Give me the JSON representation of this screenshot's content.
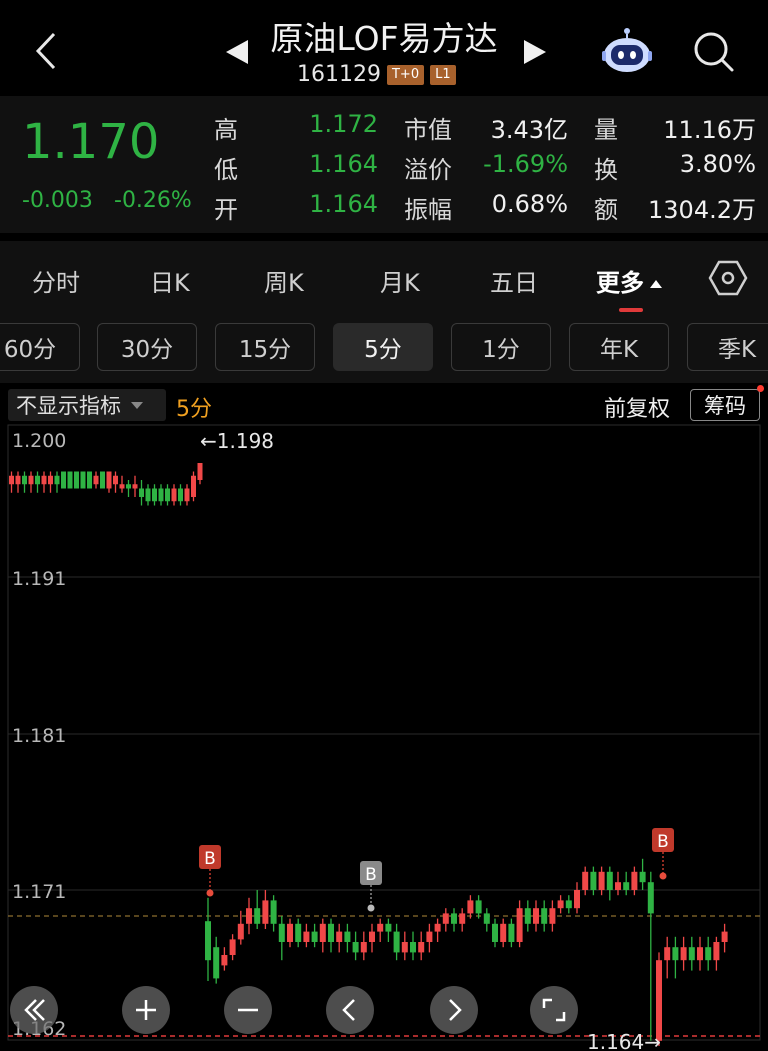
{
  "header": {
    "title": "原油LOF易方达",
    "code": "161129",
    "tags": [
      "T+0",
      "L1"
    ]
  },
  "quote": {
    "price": "1.170",
    "change": "-0.003",
    "change_pct": "-0.26%",
    "high_label": "高",
    "high": "1.172",
    "low_label": "低",
    "low": "1.164",
    "open_label": "开",
    "open": "1.164",
    "mktcap_label": "市值",
    "mktcap": "3.43亿",
    "premium_label": "溢价",
    "premium": "-1.69%",
    "amplitude_label": "振幅",
    "amplitude": "0.68%",
    "volume_label": "量",
    "volume": "11.16万",
    "turnover_label": "换",
    "turnover": "3.80%",
    "amount_label": "额",
    "amount": "1304.2万",
    "colors": {
      "down": "#2fb344",
      "up": "#f04848"
    }
  },
  "tabs": [
    "分时",
    "日K",
    "周K",
    "月K",
    "五日",
    "更多"
  ],
  "active_tab": "更多",
  "periods": [
    "60分",
    "30分",
    "15分",
    "5分",
    "1分",
    "年K",
    "季K"
  ],
  "selected_period": "5分",
  "chart_toolbar": {
    "indicator_label": "不显示指标",
    "indicator_value": "5分",
    "adjust_label": "前复权",
    "chip_label": "筹码"
  },
  "chart_data": {
    "type": "candlestick",
    "y_ticks": [
      "1.200",
      "1.191",
      "1.181",
      "1.171",
      "1.162"
    ],
    "ylim": [
      1.162,
      1.2
    ],
    "reference_price": 1.17,
    "max_label": "←1.198",
    "min_label": "1.164→",
    "signals": [
      {
        "label": "B",
        "style": "red"
      },
      {
        "label": "B",
        "style": "gray"
      },
      {
        "label": "B",
        "style": "red"
      }
    ],
    "candles_top": [
      {
        "o": 1.1946,
        "c": 1.195,
        "h": 1.1952,
        "l": 1.1942
      },
      {
        "o": 1.1946,
        "c": 1.195,
        "h": 1.1952,
        "l": 1.1942
      },
      {
        "o": 1.195,
        "c": 1.1946,
        "h": 1.1952,
        "l": 1.1942
      },
      {
        "o": 1.1946,
        "c": 1.195,
        "h": 1.1952,
        "l": 1.1942
      },
      {
        "o": 1.195,
        "c": 1.1946,
        "h": 1.1952,
        "l": 1.1942
      },
      {
        "o": 1.1946,
        "c": 1.195,
        "h": 1.1952,
        "l": 1.1942
      },
      {
        "o": 1.1946,
        "c": 1.195,
        "h": 1.1952,
        "l": 1.1942
      },
      {
        "o": 1.195,
        "c": 1.1946,
        "h": 1.1952,
        "l": 1.1942
      },
      {
        "o": 1.1952,
        "c": 1.1944,
        "h": 1.1952,
        "l": 1.1944
      },
      {
        "o": 1.1952,
        "c": 1.1944,
        "h": 1.1952,
        "l": 1.1944
      },
      {
        "o": 1.1952,
        "c": 1.1944,
        "h": 1.1952,
        "l": 1.1944
      },
      {
        "o": 1.1952,
        "c": 1.1944,
        "h": 1.1952,
        "l": 1.1944
      },
      {
        "o": 1.1952,
        "c": 1.1944,
        "h": 1.1952,
        "l": 1.1944
      },
      {
        "o": 1.1946,
        "c": 1.195,
        "h": 1.1952,
        "l": 1.1944
      },
      {
        "o": 1.1952,
        "c": 1.1944,
        "h": 1.1952,
        "l": 1.1944
      },
      {
        "o": 1.1944,
        "c": 1.1952,
        "h": 1.1952,
        "l": 1.1942
      },
      {
        "o": 1.1946,
        "c": 1.195,
        "h": 1.1952,
        "l": 1.1942
      },
      {
        "o": 1.1944,
        "c": 1.1946,
        "h": 1.195,
        "l": 1.1942
      },
      {
        "o": 1.1946,
        "c": 1.1944,
        "h": 1.1948,
        "l": 1.194
      },
      {
        "o": 1.1944,
        "c": 1.1946,
        "h": 1.195,
        "l": 1.194
      },
      {
        "o": 1.1944,
        "c": 1.194,
        "h": 1.1948,
        "l": 1.1936
      },
      {
        "o": 1.1944,
        "c": 1.1938,
        "h": 1.1946,
        "l": 1.1936
      },
      {
        "o": 1.1944,
        "c": 1.1938,
        "h": 1.1946,
        "l": 1.1936
      },
      {
        "o": 1.1944,
        "c": 1.1938,
        "h": 1.1946,
        "l": 1.1936
      },
      {
        "o": 1.1944,
        "c": 1.1938,
        "h": 1.1946,
        "l": 1.1936
      },
      {
        "o": 1.1938,
        "c": 1.1944,
        "h": 1.1946,
        "l": 1.1936
      },
      {
        "o": 1.1944,
        "c": 1.1938,
        "h": 1.1946,
        "l": 1.1936
      },
      {
        "o": 1.1938,
        "c": 1.1944,
        "h": 1.1946,
        "l": 1.1936
      },
      {
        "o": 1.194,
        "c": 1.195,
        "h": 1.1952,
        "l": 1.1938
      },
      {
        "o": 1.1948,
        "c": 1.1956,
        "h": 1.1956,
        "l": 1.1946
      }
    ],
    "candles_bottom": [
      {
        "o": 1.1698,
        "c": 1.1683,
        "h": 1.1707,
        "l": 1.1675
      },
      {
        "o": 1.1688,
        "c": 1.1676,
        "h": 1.1692,
        "l": 1.1674
      },
      {
        "o": 1.1681,
        "c": 1.1685,
        "h": 1.1688,
        "l": 1.1679
      },
      {
        "o": 1.1685,
        "c": 1.1691,
        "h": 1.1693,
        "l": 1.1683
      },
      {
        "o": 1.1691,
        "c": 1.1697,
        "h": 1.1702,
        "l": 1.1689
      },
      {
        "o": 1.1697,
        "c": 1.1703,
        "h": 1.1707,
        "l": 1.1693
      },
      {
        "o": 1.1703,
        "c": 1.1697,
        "h": 1.171,
        "l": 1.1695
      },
      {
        "o": 1.1697,
        "c": 1.1706,
        "h": 1.171,
        "l": 1.1695
      },
      {
        "o": 1.1706,
        "c": 1.1697,
        "h": 1.1708,
        "l": 1.1694
      },
      {
        "o": 1.1697,
        "c": 1.169,
        "h": 1.17,
        "l": 1.1683
      },
      {
        "o": 1.169,
        "c": 1.1697,
        "h": 1.1699,
        "l": 1.1688
      },
      {
        "o": 1.1697,
        "c": 1.169,
        "h": 1.1699,
        "l": 1.1688
      },
      {
        "o": 1.169,
        "c": 1.1694,
        "h": 1.1697,
        "l": 1.1688
      },
      {
        "o": 1.1694,
        "c": 1.169,
        "h": 1.1697,
        "l": 1.1688
      },
      {
        "o": 1.169,
        "c": 1.1697,
        "h": 1.1699,
        "l": 1.1686
      },
      {
        "o": 1.1697,
        "c": 1.169,
        "h": 1.1699,
        "l": 1.1686
      },
      {
        "o": 1.169,
        "c": 1.1694,
        "h": 1.1697,
        "l": 1.1686
      },
      {
        "o": 1.1694,
        "c": 1.169,
        "h": 1.1697,
        "l": 1.1686
      },
      {
        "o": 1.169,
        "c": 1.1686,
        "h": 1.1694,
        "l": 1.1683
      },
      {
        "o": 1.1686,
        "c": 1.169,
        "h": 1.1694,
        "l": 1.1683
      },
      {
        "o": 1.169,
        "c": 1.1694,
        "h": 1.1697,
        "l": 1.1686
      },
      {
        "o": 1.1694,
        "c": 1.1697,
        "h": 1.1699,
        "l": 1.169
      },
      {
        "o": 1.1697,
        "c": 1.1694,
        "h": 1.1699,
        "l": 1.169
      },
      {
        "o": 1.1694,
        "c": 1.1686,
        "h": 1.1697,
        "l": 1.1683
      },
      {
        "o": 1.1686,
        "c": 1.169,
        "h": 1.1694,
        "l": 1.1683
      },
      {
        "o": 1.169,
        "c": 1.1686,
        "h": 1.1694,
        "l": 1.1683
      },
      {
        "o": 1.1686,
        "c": 1.169,
        "h": 1.1694,
        "l": 1.1683
      },
      {
        "o": 1.169,
        "c": 1.1694,
        "h": 1.1697,
        "l": 1.1686
      },
      {
        "o": 1.1694,
        "c": 1.1697,
        "h": 1.1699,
        "l": 1.169
      },
      {
        "o": 1.1697,
        "c": 1.1701,
        "h": 1.1703,
        "l": 1.1694
      },
      {
        "o": 1.1701,
        "c": 1.1697,
        "h": 1.1703,
        "l": 1.1694
      },
      {
        "o": 1.1697,
        "c": 1.1701,
        "h": 1.1703,
        "l": 1.1694
      },
      {
        "o": 1.1701,
        "c": 1.1706,
        "h": 1.1708,
        "l": 1.1699
      },
      {
        "o": 1.1706,
        "c": 1.1701,
        "h": 1.1708,
        "l": 1.1699
      },
      {
        "o": 1.1701,
        "c": 1.1697,
        "h": 1.1703,
        "l": 1.1694
      },
      {
        "o": 1.1697,
        "c": 1.169,
        "h": 1.1699,
        "l": 1.1688
      },
      {
        "o": 1.169,
        "c": 1.1697,
        "h": 1.1699,
        "l": 1.1688
      },
      {
        "o": 1.1697,
        "c": 1.169,
        "h": 1.1699,
        "l": 1.1688
      },
      {
        "o": 1.169,
        "c": 1.1703,
        "h": 1.1706,
        "l": 1.1688
      },
      {
        "o": 1.1703,
        "c": 1.1697,
        "h": 1.1706,
        "l": 1.1694
      },
      {
        "o": 1.1697,
        "c": 1.1703,
        "h": 1.1706,
        "l": 1.1694
      },
      {
        "o": 1.1703,
        "c": 1.1697,
        "h": 1.1706,
        "l": 1.1694
      },
      {
        "o": 1.1697,
        "c": 1.1703,
        "h": 1.1706,
        "l": 1.1694
      },
      {
        "o": 1.1703,
        "c": 1.1706,
        "h": 1.1708,
        "l": 1.1701
      },
      {
        "o": 1.1706,
        "c": 1.1703,
        "h": 1.1708,
        "l": 1.1701
      },
      {
        "o": 1.1703,
        "c": 1.171,
        "h": 1.1713,
        "l": 1.1701
      },
      {
        "o": 1.171,
        "c": 1.1717,
        "h": 1.1719,
        "l": 1.1708
      },
      {
        "o": 1.1717,
        "c": 1.171,
        "h": 1.1719,
        "l": 1.1708
      },
      {
        "o": 1.171,
        "c": 1.1717,
        "h": 1.1719,
        "l": 1.1708
      },
      {
        "o": 1.1717,
        "c": 1.171,
        "h": 1.1719,
        "l": 1.1706
      },
      {
        "o": 1.171,
        "c": 1.1713,
        "h": 1.1717,
        "l": 1.1708
      },
      {
        "o": 1.1713,
        "c": 1.171,
        "h": 1.1717,
        "l": 1.1708
      },
      {
        "o": 1.171,
        "c": 1.1717,
        "h": 1.1719,
        "l": 1.1708
      },
      {
        "o": 1.1717,
        "c": 1.1713,
        "h": 1.1722,
        "l": 1.171
      },
      {
        "o": 1.1713,
        "c": 1.1701,
        "h": 1.1717,
        "l": 1.1652
      },
      {
        "o": 1.1652,
        "c": 1.1683,
        "h": 1.1686,
        "l": 1.165
      },
      {
        "o": 1.1683,
        "c": 1.1688,
        "h": 1.1692,
        "l": 1.1676
      },
      {
        "o": 1.1688,
        "c": 1.1683,
        "h": 1.1692,
        "l": 1.1676
      },
      {
        "o": 1.1683,
        "c": 1.1688,
        "h": 1.1692,
        "l": 1.1679
      },
      {
        "o": 1.1688,
        "c": 1.1683,
        "h": 1.1692,
        "l": 1.1679
      },
      {
        "o": 1.1683,
        "c": 1.1688,
        "h": 1.1692,
        "l": 1.1679
      },
      {
        "o": 1.1688,
        "c": 1.1683,
        "h": 1.1692,
        "l": 1.1679
      },
      {
        "o": 1.1683,
        "c": 1.169,
        "h": 1.1692,
        "l": 1.1679
      },
      {
        "o": 1.169,
        "c": 1.1694,
        "h": 1.1697,
        "l": 1.1686
      }
    ],
    "controls": [
      "double-left-icon",
      "zoom-in-icon",
      "zoom-out-icon",
      "prev-icon",
      "next-icon",
      "fullscreen-icon"
    ]
  }
}
